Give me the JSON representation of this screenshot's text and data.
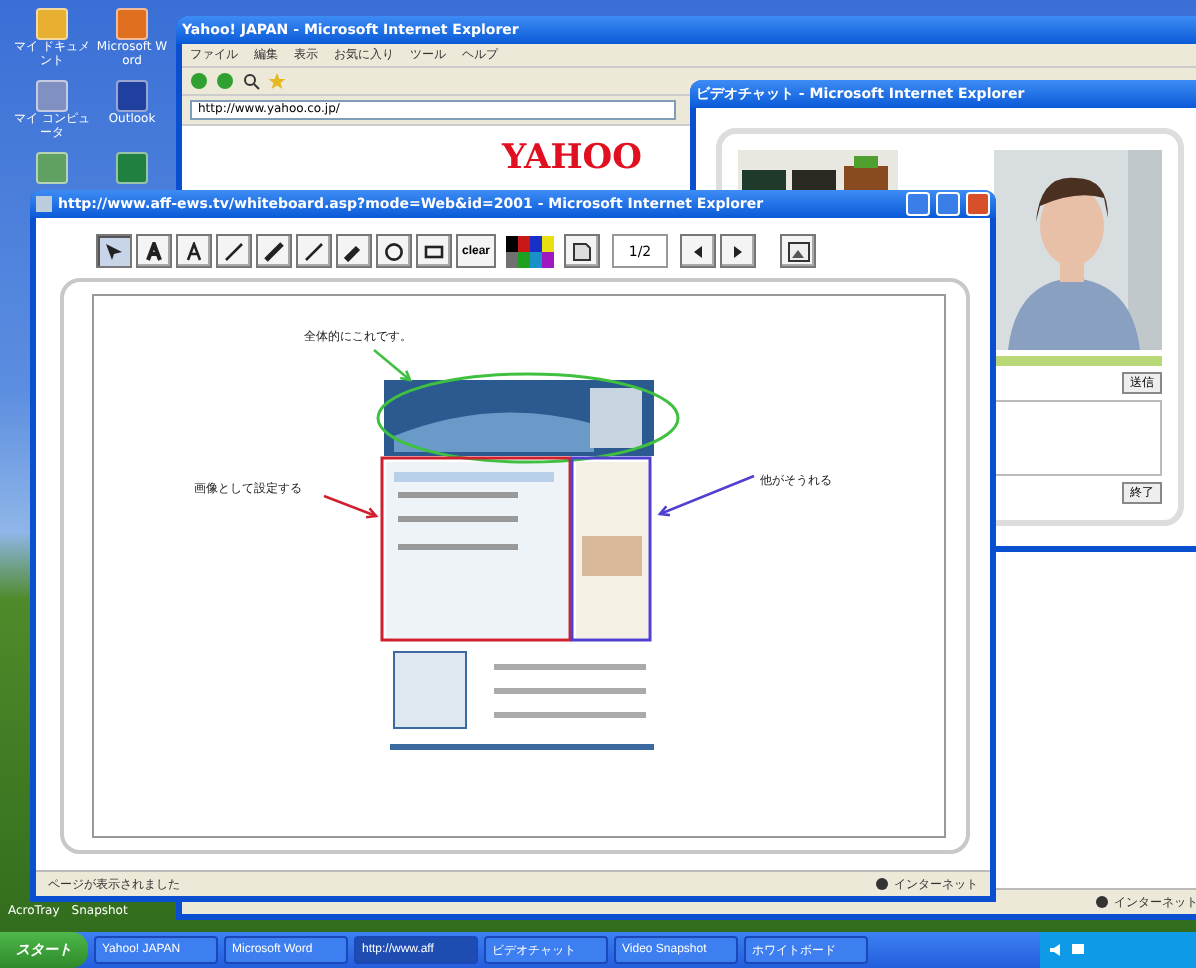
{
  "desktop_icons": [
    {
      "label": "マイ ドキュメント"
    },
    {
      "label": "Microsoft Word"
    },
    {
      "label": "マイ コンピュータ"
    },
    {
      "label": "Outlook"
    },
    {
      "label": "AcroTray"
    },
    {
      "label": "Snapshot"
    }
  ],
  "yahoo_window": {
    "title": "Yahoo! JAPAN - Microsoft Internet Explorer",
    "menu": [
      "ファイル",
      "編集",
      "表示",
      "お気に入り",
      "ツール",
      "ヘルプ"
    ],
    "address": "http://www.yahoo.co.jp/",
    "logo": "YAHOO",
    "status": "インターネット"
  },
  "chat_window": {
    "title": "ビデオチャット - Microsoft Internet Explorer",
    "buttons": [
      "送信",
      "終了"
    ]
  },
  "whiteboard_window": {
    "title": "http://www.aff-ews.tv/whiteboard.asp?mode=Web&id=2001 - Microsoft Internet Explorer",
    "tools": [
      {
        "kind": "pointer",
        "selected": true
      },
      {
        "kind": "text-bold",
        "selected": false
      },
      {
        "kind": "text",
        "selected": false
      },
      {
        "kind": "line",
        "selected": false
      },
      {
        "kind": "thick-line",
        "selected": false
      },
      {
        "kind": "line",
        "selected": false
      },
      {
        "kind": "pen",
        "selected": false
      },
      {
        "kind": "ellipse",
        "selected": false
      },
      {
        "kind": "rectangle",
        "selected": false
      }
    ],
    "clear_label": "clear",
    "palette": [
      {
        "color": "#000000"
      },
      {
        "color": "#c81818"
      },
      {
        "color": "#1830c8"
      },
      {
        "color": "#e8e010"
      },
      {
        "color": "#707070"
      },
      {
        "color": "#20a020"
      },
      {
        "color": "#1890c8"
      },
      {
        "color": "#a018c0"
      }
    ],
    "page": "1/2",
    "annotations": [
      {
        "text": "全体的にこれです。",
        "color": "#40c040"
      },
      {
        "text": "画像として設定する",
        "color": "#d02030"
      },
      {
        "text": "他がそうれる",
        "color": "#5040d0"
      }
    ],
    "status": "ページが表示されました",
    "zone": "インターネット"
  },
  "taskbar": {
    "start": "スタート",
    "tasks": [
      {
        "label": "Yahoo! JAPAN",
        "selected": false
      },
      {
        "label": "Microsoft Word",
        "selected": false
      },
      {
        "label": "http://www.aff",
        "selected": true
      },
      {
        "label": "ビデオチャット",
        "selected": false
      },
      {
        "label": "Video Snapshot",
        "selected": false
      },
      {
        "label": "ホワイトボード",
        "selected": false
      }
    ]
  }
}
